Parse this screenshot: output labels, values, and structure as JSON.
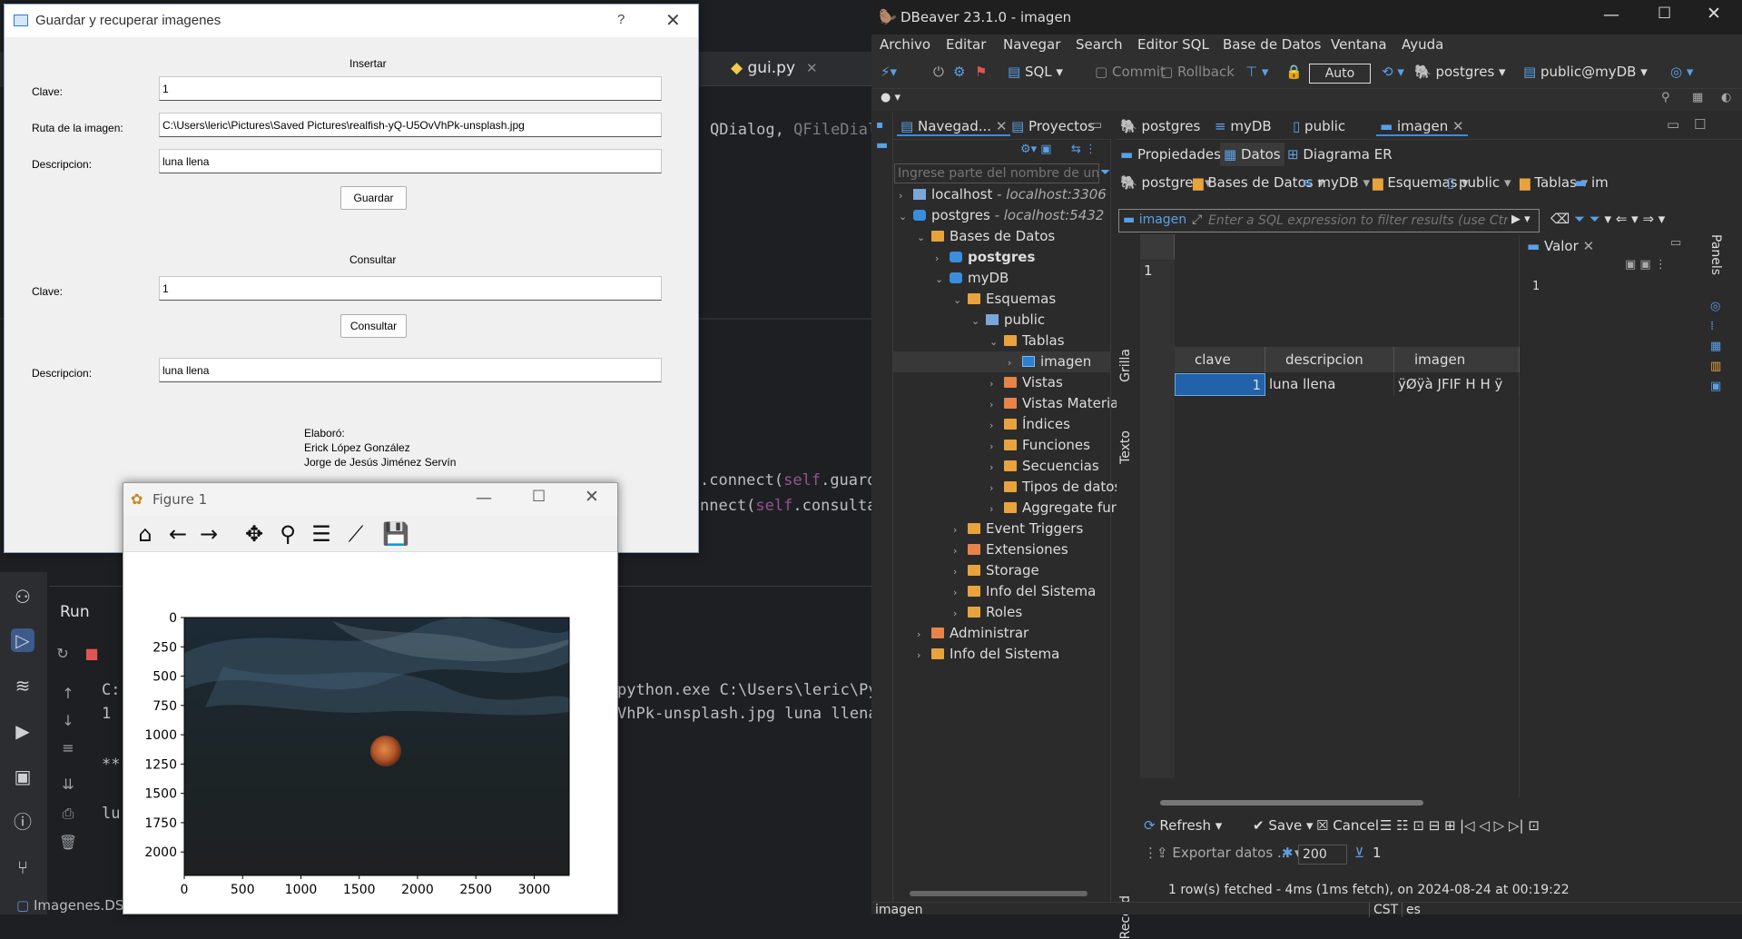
{
  "ide": {
    "tab_label": "gui.py",
    "code_lines": [
      {
        "kw": "",
        "text": "QDialog, ",
        "dim": "QFileDial"
      },
      {
        "pre": ".connect(",
        "self": "self",
        "post": ".guard"
      },
      {
        "pre": "nnect(",
        "self": "self",
        "post": ".consulta"
      },
      {
        "text": "python.exe C:\\Users\\leric\\Py"
      },
      {
        "text": "VhPk-unsplash.jpg luna llena"
      }
    ],
    "run_title": "Run",
    "console_left": [
      "C:",
      "1",
      "**",
      "lu"
    ],
    "status_left": "Imagenes.DS"
  },
  "dialog": {
    "title": "Guardar y recuperar imagenes",
    "help": "?",
    "close": "✕",
    "insert_header": "Insertar",
    "clave_label": "Clave:",
    "clave_value": "1",
    "ruta_label": "Ruta de la imagen:",
    "ruta_value": "C:\\Users\\leric\\Pictures\\Saved Pictures\\realfish-yQ-U5OvVhPk-unsplash.jpg",
    "desc_label": "Descripcion:",
    "desc_value": "luna llena",
    "save_button": "Guardar",
    "query_header": "Consultar",
    "query_clave_label": "Clave:",
    "query_clave_value": "1",
    "query_button": "Consultar",
    "query_desc_label": "Descripcion:",
    "query_desc_value": "luna llena",
    "credits": [
      "Elaboró:",
      "Erick López González",
      "Jorge de Jesús Jiménez Servín"
    ]
  },
  "figure": {
    "title": "Figure 1",
    "x_ticks": [
      "0",
      "500",
      "1000",
      "1500",
      "2000",
      "2500",
      "3000"
    ],
    "y_ticks": [
      "0",
      "250",
      "500",
      "750",
      "1000",
      "1250",
      "1500",
      "1750",
      "2000"
    ]
  },
  "dbeaver": {
    "title": "DBeaver 23.1.0 - imagen",
    "menu": [
      "Archivo",
      "Editar",
      "Navegar",
      "Search",
      "Editor SQL",
      "Base de Datos",
      "Ventana",
      "Ayuda"
    ],
    "toolbar": {
      "sql": "SQL",
      "commit": "Commit",
      "rollback": "Rollback",
      "auto": "Auto",
      "db": "postgres",
      "schema": "public@myDB"
    },
    "nav_tab": "Navegad...",
    "proj_tab": "Proyectos",
    "filter_placeholder": "Ingrese parte del nombre de un o",
    "tree": [
      {
        "label": "localhost",
        "detail": " - localhost:3306"
      },
      {
        "label": "postgres",
        "detail": " - localhost:5432"
      },
      {
        "label": "Bases de Datos"
      },
      {
        "label": "postgres"
      },
      {
        "label": "myDB"
      },
      {
        "label": "Esquemas"
      },
      {
        "label": "public"
      },
      {
        "label": "Tablas"
      },
      {
        "label": "imagen"
      },
      {
        "label": "Vistas"
      },
      {
        "label": "Vistas Materializada"
      },
      {
        "label": "Índices"
      },
      {
        "label": "Funciones"
      },
      {
        "label": "Secuencias"
      },
      {
        "label": "Tipos de datos"
      },
      {
        "label": "Aggregate functions"
      },
      {
        "label": "Event Triggers"
      },
      {
        "label": "Extensiones"
      },
      {
        "label": "Storage"
      },
      {
        "label": "Info del Sistema"
      },
      {
        "label": "Roles"
      },
      {
        "label": "Administrar"
      },
      {
        "label": "Info del Sistema"
      }
    ],
    "editor_tabs": [
      "postgres",
      "myDB",
      "public",
      "imagen"
    ],
    "sub_tabs": [
      "Propiedades",
      "Datos",
      "Diagrama ER"
    ],
    "breadcrumb": [
      "postgres",
      "Bases de Datos",
      "myDB",
      "Esquemas",
      "public",
      "Tablas",
      "im"
    ],
    "filter_table": "imagen",
    "filter_placeholder2": "Enter a SQL expression to filter results (use Ctrl+Sp",
    "side_tabs": [
      "Grilla",
      "Texto",
      "Record"
    ],
    "columns": [
      "clave",
      "descripcion",
      "imagen"
    ],
    "row": {
      "num": "1",
      "clave": "1",
      "descripcion": "luna llena",
      "imagen": "ÿØÿà  JFIF      H  H  ÿ"
    },
    "value_panel_title": "Valor",
    "value_panel_content": "1",
    "right_panel_label": "Panels",
    "bottom": {
      "refresh": "Refresh",
      "save": "Save",
      "cancel": "Cancel",
      "export": "Exportar datos ...",
      "limit": "200",
      "count": "1"
    },
    "status": "1 row(s) fetched - 4ms (1ms fetch), on 2024-08-24 at 00:19:22",
    "statusbar": [
      "imagen",
      "CST",
      "es"
    ]
  }
}
